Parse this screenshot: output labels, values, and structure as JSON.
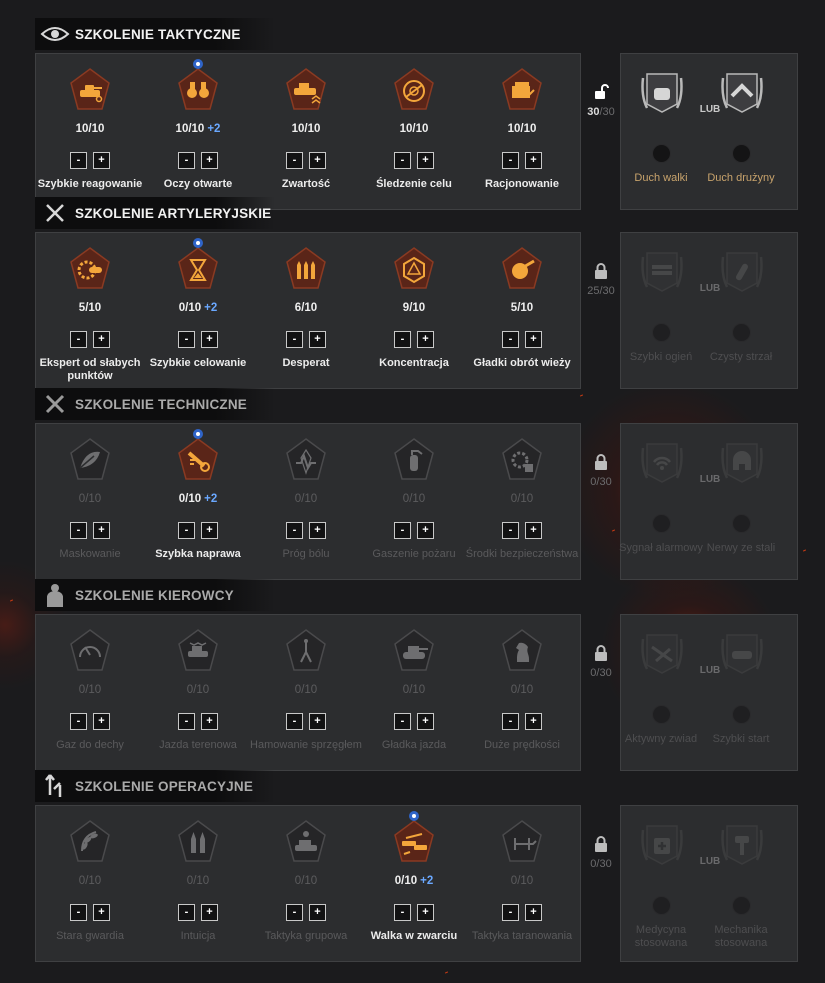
{
  "colors": {
    "active_icon": "#f3a63b",
    "badge_fill": "#5a2518",
    "dim_icon": "#6e6e70",
    "plus": "#6aa8ff",
    "perk_text": "#c8a36c"
  },
  "sections": [
    {
      "title": "SZKOLENIE TAKTYCZNE",
      "icon": "eye-icon",
      "count": "30",
      "max": "/30",
      "lock": "unlock-icon",
      "skills": [
        {
          "name": "Szybkie reagowanie",
          "level": "10/10",
          "bonus": "",
          "active": true,
          "icon": "tank-eye-icon",
          "crew": false
        },
        {
          "name": "Oczy otwarte",
          "level": "10/10",
          "bonus": "+2",
          "active": true,
          "icon": "binoculars-icon",
          "crew": true
        },
        {
          "name": "Zwartość",
          "level": "10/10",
          "bonus": "",
          "active": true,
          "icon": "tank-chevrons-icon",
          "crew": false
        },
        {
          "name": "Śledzenie celu",
          "level": "10/10",
          "bonus": "",
          "active": true,
          "icon": "target-ring-icon",
          "crew": false
        },
        {
          "name": "Racjonowanie",
          "level": "10/10",
          "bonus": "",
          "active": true,
          "icon": "crate-icon",
          "crew": false
        }
      ],
      "perks": {
        "left": "Duch walki",
        "or": "LUB",
        "right": "Duch drużyny",
        "left_icon": "fist-icon",
        "right_icon": "handshake-icon",
        "locked": false
      }
    },
    {
      "title": "SZKOLENIE ARTYLERYJSKIE",
      "icon": "crossed-swords-icon",
      "count": "25/30",
      "max": "",
      "lock": "lock-icon",
      "skills": [
        {
          "name": "Ekspert od słabych punktów",
          "level": "5/10",
          "bonus": "",
          "active": true,
          "icon": "gear-shell-icon",
          "crew": false
        },
        {
          "name": "Szybkie celowanie",
          "level": "0/10",
          "bonus": "+2",
          "active": true,
          "icon": "hourglass-icon",
          "crew": true
        },
        {
          "name": "Desperat",
          "level": "6/10",
          "bonus": "",
          "active": true,
          "icon": "shells-icon",
          "crew": false
        },
        {
          "name": "Koncentracja",
          "level": "9/10",
          "bonus": "",
          "active": true,
          "icon": "d20-icon",
          "crew": false
        },
        {
          "name": "Gładki obrót wieży",
          "level": "5/10",
          "bonus": "",
          "active": true,
          "icon": "turret-icon",
          "crew": false
        }
      ],
      "perks": {
        "left": "Szybki ogień",
        "or": "LUB",
        "right": "Czysty strzał",
        "left_icon": "rounds-icon",
        "right_icon": "shell-icon",
        "locked": true
      }
    },
    {
      "title": "SZKOLENIE TECHNICZNE",
      "icon": "wrench-icon",
      "count": "0/30",
      "max": "",
      "lock": "lock-icon",
      "skills": [
        {
          "name": "Maskowanie",
          "level": "0/10",
          "bonus": "",
          "active": false,
          "icon": "camo-leaf-icon",
          "crew": false
        },
        {
          "name": "Szybka naprawa",
          "level": "0/10",
          "bonus": "+2",
          "active": true,
          "icon": "repair-icon",
          "crew": true
        },
        {
          "name": "Próg bólu",
          "level": "0/10",
          "bonus": "",
          "active": false,
          "icon": "pulse-icon",
          "crew": false
        },
        {
          "name": "Gaszenie pożaru",
          "level": "0/10",
          "bonus": "",
          "active": false,
          "icon": "extinguisher-icon",
          "crew": false
        },
        {
          "name": "Środki bezpieczeństwa",
          "level": "0/10",
          "bonus": "",
          "active": false,
          "icon": "cog-box-icon",
          "crew": false
        }
      ],
      "perks": {
        "left": "Sygnał alarmowy",
        "or": "LUB",
        "right": "Nerwy ze stali",
        "left_icon": "signal-icon",
        "right_icon": "helmet-icon",
        "locked": true
      }
    },
    {
      "title": "SZKOLENIE KIEROWCY",
      "icon": "driver-icon",
      "count": "0/30",
      "max": "",
      "lock": "lock-icon",
      "skills": [
        {
          "name": "Gaz do dechy",
          "level": "0/10",
          "bonus": "",
          "active": false,
          "icon": "speedometer-icon",
          "crew": false
        },
        {
          "name": "Jazda terenowa",
          "level": "0/10",
          "bonus": "",
          "active": false,
          "icon": "offroad-icon",
          "crew": false
        },
        {
          "name": "Hamowanie sprzęgłem",
          "level": "0/10",
          "bonus": "",
          "active": false,
          "icon": "clutch-icon",
          "crew": false
        },
        {
          "name": "Gładka jazda",
          "level": "0/10",
          "bonus": "",
          "active": false,
          "icon": "tank-icon",
          "crew": false
        },
        {
          "name": "Duże prędkości",
          "level": "0/10",
          "bonus": "",
          "active": false,
          "icon": "knight-icon",
          "crew": false
        }
      ],
      "perks": {
        "left": "Aktywny zwiad",
        "or": "LUB",
        "right": "Szybki start",
        "left_icon": "scout-icon",
        "right_icon": "track-icon",
        "locked": true
      }
    },
    {
      "title": "SZKOLENIE OPERACYJNE",
      "icon": "arrows-icon",
      "count": "0/30",
      "max": "",
      "lock": "lock-icon",
      "skills": [
        {
          "name": "Stara gwardia",
          "level": "0/10",
          "bonus": "",
          "active": false,
          "icon": "laurel-icon",
          "crew": false
        },
        {
          "name": "Intuicja",
          "level": "0/10",
          "bonus": "",
          "active": false,
          "icon": "bullets-icon",
          "crew": false
        },
        {
          "name": "Taktyka grupowa",
          "level": "0/10",
          "bonus": "",
          "active": false,
          "icon": "tank-group-icon",
          "crew": false
        },
        {
          "name": "Walka w zwarciu",
          "level": "0/10",
          "bonus": "+2",
          "active": true,
          "icon": "melee-icon",
          "crew": true
        },
        {
          "name": "Taktyka taranowania",
          "level": "0/10",
          "bonus": "",
          "active": false,
          "icon": "ram-icon",
          "crew": false
        }
      ],
      "perks": {
        "left": "Medycyna stosowana",
        "or": "LUB",
        "right": "Mechanika stosowana",
        "left_icon": "medkit-icon",
        "right_icon": "hammer-icon",
        "locked": true
      }
    }
  ]
}
